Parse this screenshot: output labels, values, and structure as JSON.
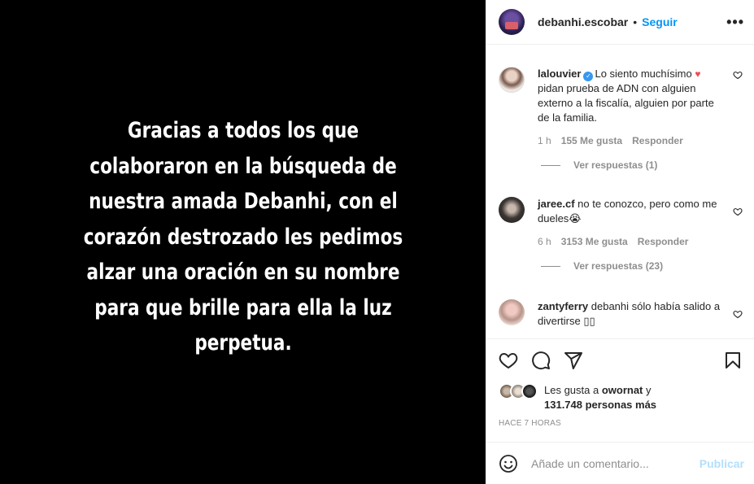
{
  "media": {
    "text": "Gracias a todos los que colaboraron en la búsqueda de nuestra amada Debanhi, con el corazón destrozado les pedimos alzar una oración en su nombre para que brille para ella la luz perpetua."
  },
  "header": {
    "username": "debanhi.escobar",
    "separator": "•",
    "follow_label": "Seguir",
    "more_label": "•••"
  },
  "comments": [
    {
      "username": "lalouvier",
      "text_before_heart": "Lo siento muchísimo ",
      "heart": "♥",
      "text_after": " pidan prueba de ADN con alguien externo a la fiscalía, alguien por parte de la familia.",
      "time": "1 h",
      "likes": "155 Me gusta",
      "reply": "Responder",
      "view_replies": "Ver respuestas (1)"
    },
    {
      "username": "jaree.cf",
      "text": "no te conozco, pero como me dueles😭",
      "time": "6 h",
      "likes": "3153 Me gusta",
      "reply": "Responder",
      "view_replies": "Ver respuestas (23)"
    },
    {
      "username": "zantyferry",
      "text": "debanhi sólo había salido a divertirse ▯▯"
    }
  ],
  "icons": {
    "like": "heart-outline-icon",
    "comment": "speech-bubble-icon",
    "share": "paper-plane-icon",
    "save": "bookmark-icon",
    "emoji": "smiley-icon"
  },
  "likes": {
    "prefix": "Les gusta a ",
    "user": "owornat",
    "middle": " y",
    "count": "131.748 personas más"
  },
  "timestamp": "HACE 7 HORAS",
  "composer": {
    "placeholder": "Añade un comentario...",
    "post_label": "Publicar"
  },
  "colors": {
    "accent": "#0095f6",
    "post_disabled": "#b2dffc",
    "verified": "#3897f0",
    "heart": "#ed4956"
  }
}
